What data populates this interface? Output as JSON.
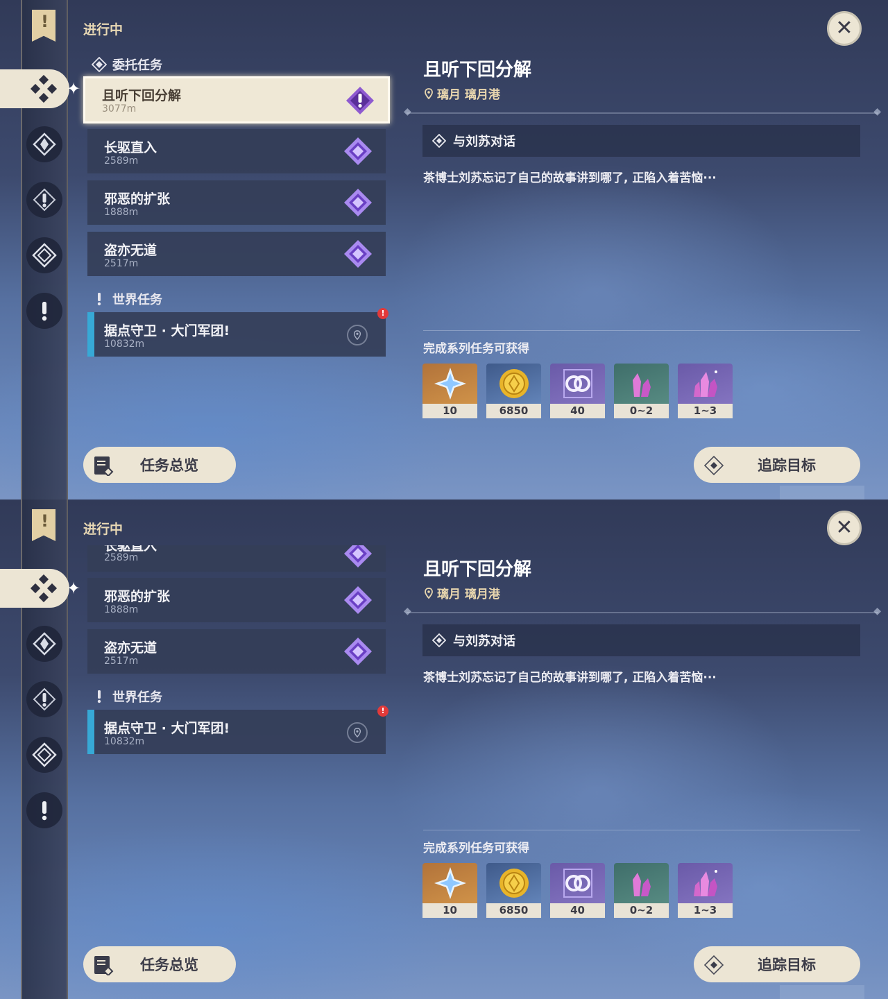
{
  "panels": {
    "top": {
      "section_head": "进行中",
      "commission_category": "委托任务",
      "world_category": "世界任务",
      "quests": [
        {
          "name": "且听下回分解",
          "distance": "3077m"
        },
        {
          "name": "长驱直入",
          "distance": "2589m"
        },
        {
          "name": "邪恶的扩张",
          "distance": "1888m"
        },
        {
          "name": "盗亦无道",
          "distance": "2517m"
        }
      ],
      "world_quest": {
        "name": "据点守卫 · 大门军团!",
        "distance": "10832m",
        "alert": "!"
      }
    },
    "bottom": {
      "section_head": "进行中",
      "world_category": "世界任务",
      "quests": [
        {
          "name": "长驱直入",
          "distance": "2589m"
        },
        {
          "name": "邪恶的扩张",
          "distance": "1888m"
        },
        {
          "name": "盗亦无道",
          "distance": "2517m"
        }
      ],
      "world_quest": {
        "name": "据点守卫 · 大门军团!",
        "distance": "10832m",
        "alert": "!"
      }
    }
  },
  "detail": {
    "title": "且听下回分解",
    "location": "璃月 璃月港",
    "objective": "与刘苏对话",
    "description": "茶博士刘苏忘记了自己的故事讲到哪了, 正陷入着苦恼···",
    "reward_label": "完成系列任务可获得",
    "rewards": [
      {
        "icon": "primogem-icon",
        "count": "10"
      },
      {
        "icon": "mora-icon",
        "count": "6850"
      },
      {
        "icon": "adventure-exp-icon",
        "count": "40"
      },
      {
        "icon": "crystal-small-icon",
        "count": "0~2"
      },
      {
        "icon": "crystal-large-icon",
        "count": "1~3"
      }
    ]
  },
  "buttons": {
    "overview": "任务总览",
    "track": "追踪目标"
  },
  "colors": {
    "accent_gold": "#e8d8b4",
    "world_quest_bar": "#37a9d6",
    "alert_red": "#e23a3a",
    "pill_bg": "#ece5d4"
  }
}
